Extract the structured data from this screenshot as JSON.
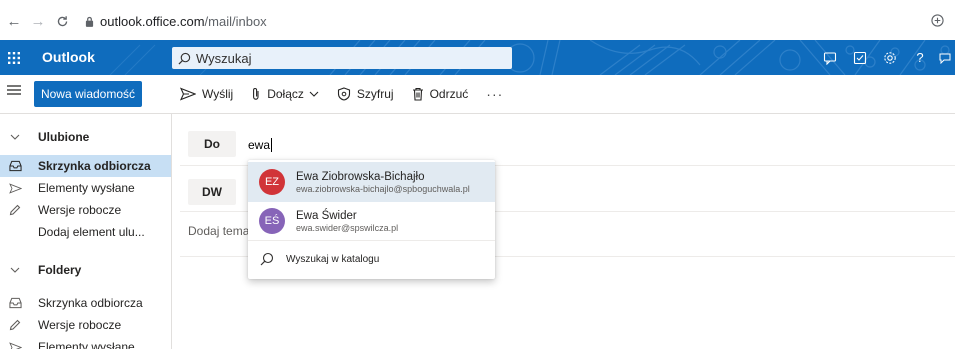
{
  "browser": {
    "url_host": "outlook.office.com",
    "url_path": "/mail/inbox",
    "back_icon": "arrow-left",
    "forward_icon": "arrow-right",
    "reload_icon": "reload",
    "extension_icon": "plus-circle"
  },
  "header": {
    "brand": "Outlook",
    "search_placeholder": "Wyszukaj",
    "accent": "#0f6cbd"
  },
  "left": {
    "new_message": "Nowa wiadomość"
  },
  "toolbar": {
    "send": "Wyślij",
    "attach": "Dołącz",
    "encrypt": "Szyfruj",
    "discard": "Odrzuć",
    "more": "···"
  },
  "sidebar": {
    "favorites_label": "Ulubione",
    "favorites": [
      {
        "label": "Skrzynka odbiorcza",
        "icon": "inbox-icon",
        "selected": true
      },
      {
        "label": "Elementy wysłane",
        "icon": "send-icon"
      },
      {
        "label": "Wersje robocze",
        "icon": "pencil-icon"
      },
      {
        "label": "Dodaj element ulu..."
      }
    ],
    "folders_label": "Foldery",
    "folders": [
      {
        "label": "Skrzynka odbiorcza",
        "icon": "inbox-icon"
      },
      {
        "label": "Wersje robocze",
        "icon": "pencil-icon"
      },
      {
        "label": "Elementy wysłane",
        "icon": "send-icon"
      }
    ]
  },
  "compose": {
    "to_label": "Do",
    "to_value": "ewa",
    "cc_label": "DW",
    "subject_placeholder": "Dodaj tema"
  },
  "suggestions": [
    {
      "initials": "EZ",
      "name": "Ewa Ziobrowska-Bichajło",
      "email": "ewa.ziobrowska-bichajlo@spboguchwala.pl",
      "color": "#d13438"
    },
    {
      "initials": "EŚ",
      "name": "Ewa Świder",
      "email": "ewa.swider@spswilcza.pl",
      "color": "#8764b8"
    }
  ],
  "directory_search": "Wyszukaj w katalogu"
}
